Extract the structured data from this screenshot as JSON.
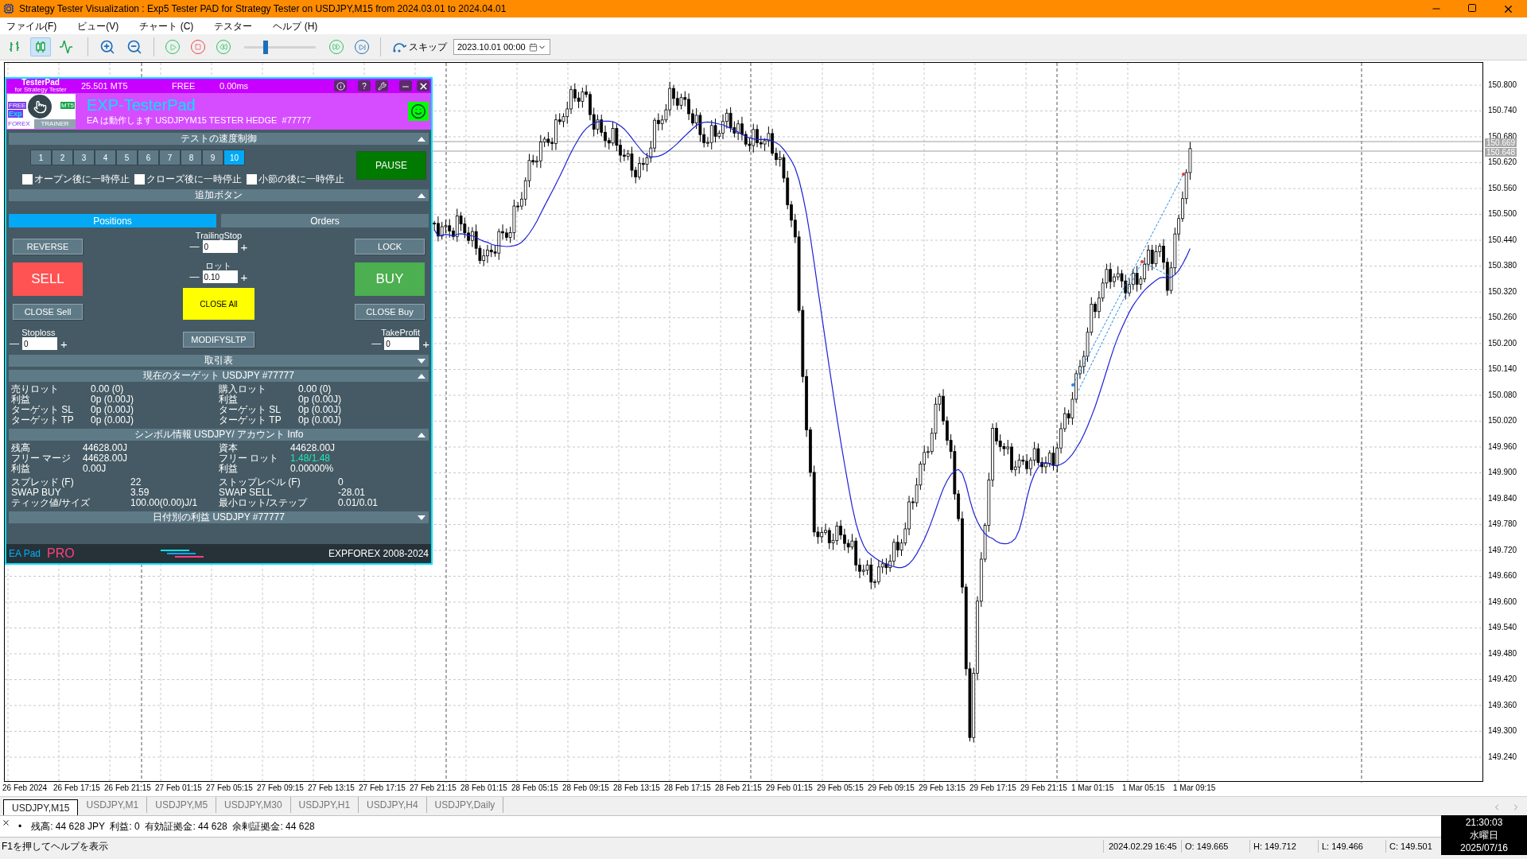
{
  "window": {
    "title": "Strategy Tester Visualization : Exp5 Tester PAD for Strategy Tester on USDJPY,M15 from 2024.03.01 to 2024.04.01"
  },
  "menu": [
    "ファイル(F)",
    "ビュー(V)",
    "チャート (C)",
    "テスター",
    "ヘルプ (H)"
  ],
  "toolbar": {
    "chart_modes": [
      {
        "kind": "bars",
        "selected": false
      },
      {
        "kind": "candles",
        "selected": true
      },
      {
        "kind": "line",
        "selected": false
      }
    ],
    "speed": {
      "level": 0.3
    },
    "skip": "スキップ",
    "date": "2023.10.01 00:00"
  },
  "pad": {
    "brand": "TesterPad",
    "brand_sub": "for Strategy Tester",
    "version": "25.501 MT5",
    "license": "FREE",
    "latency": "0.00ms",
    "help": "?",
    "logo": {
      "free": "FREE",
      "mt5": "MT5",
      "exp": "Exp",
      "forex": "FOREX",
      "trainer": "TRAINER"
    },
    "title": "EXP-TesterPad",
    "status": "EA は動作します USDJPYM15 TESTER HEDGE  #77777",
    "speed_section": {
      "title": "テストの速度制御",
      "expanded": true
    },
    "speeds": [
      {
        "label": "1",
        "selected": false
      },
      {
        "label": "2",
        "selected": false
      },
      {
        "label": "3",
        "selected": false
      },
      {
        "label": "4",
        "selected": false
      },
      {
        "label": "5",
        "selected": false
      },
      {
        "label": "6",
        "selected": false
      },
      {
        "label": "7",
        "selected": false
      },
      {
        "label": "8",
        "selected": false
      },
      {
        "label": "9",
        "selected": false
      },
      {
        "label": "10",
        "selected": true
      }
    ],
    "pause": "PAUSE",
    "pause_options": [
      {
        "label": "オープン後に一時停止",
        "checked": false
      },
      {
        "label": "クローズ後に一時停止",
        "checked": false
      },
      {
        "label": "小節の後に一時停止",
        "checked": false
      }
    ],
    "extra_section": {
      "title": "追加ボタン",
      "expanded": true
    },
    "tabs": [
      {
        "label": "Positions",
        "selected": true
      },
      {
        "label": "Orders",
        "selected": false
      }
    ],
    "reverse": "REVERSE",
    "lock": "LOCK",
    "sell": "SELL",
    "buy": "BUY",
    "close_sell": "CLOSE Sell",
    "close_all": "CLOSE All",
    "close_buy": "CLOSE Buy",
    "modify": "MODIFYSLTP",
    "trailing": {
      "label": "TrailingStop",
      "value": "0"
    },
    "lot": {
      "label": "ロット",
      "value": "0.10"
    },
    "stoploss": {
      "label": "Stoploss",
      "value": "0"
    },
    "takeprofit": {
      "label": "TakeProfit",
      "value": "0"
    },
    "minus": "—",
    "plus": "+",
    "trade_section": {
      "title": "取引表",
      "expanded": false
    },
    "target_section": {
      "title": "現在のターゲット USDJPY #77777",
      "expanded": true
    },
    "target": {
      "left": [
        {
          "label": "売りロット",
          "value": "0.00 (0)"
        },
        {
          "label": "利益",
          "value": "0p (0.00J)"
        },
        {
          "label": "ターゲット SL",
          "value": "0p (0.00J)"
        },
        {
          "label": "ターゲット TP",
          "value": "0p (0.00J)"
        }
      ],
      "right": [
        {
          "label": "購入ロット",
          "value": "0.00 (0)"
        },
        {
          "label": "利益",
          "value": "0p (0.00J)"
        },
        {
          "label": "ターゲット SL",
          "value": "0p (0.00J)"
        },
        {
          "label": "ターゲット TP",
          "value": "0p (0.00J)"
        }
      ]
    },
    "symbol_section": {
      "title": "シンボル情報 USDJPY/ アカウント Info",
      "expanded": true
    },
    "account": {
      "left": [
        {
          "label": "残高",
          "value": "44628.00J",
          "highlighted": false
        },
        {
          "label": "フリー マージ",
          "value": "44628.00J",
          "highlighted": false
        },
        {
          "label": "利益",
          "value": "0.00J",
          "highlighted": false
        }
      ],
      "right": [
        {
          "label": "資本",
          "value": "44628.00J",
          "highlighted": false
        },
        {
          "label": "フリー ロット",
          "value": "1.48/1.48",
          "highlighted": true
        },
        {
          "label": "利益",
          "value": "0.00000%",
          "highlighted": false
        }
      ]
    },
    "symbol": {
      "left": [
        {
          "label": "スプレッド (F)",
          "value": "22"
        },
        {
          "label": "SWAP BUY",
          "value": "3.59"
        },
        {
          "label": "ティック値/サイズ",
          "value": "100.00(0.00)J/1"
        }
      ],
      "right": [
        {
          "label": "ストップレベル (F)",
          "value": "0"
        },
        {
          "label": "SWAP SELL",
          "value": "-28.01"
        },
        {
          "label": "最小ロット/ステップ",
          "value": "0.01/0.01"
        }
      ]
    },
    "daily_section": {
      "title": "日付別の利益 USDJPY #77777",
      "expanded": false
    },
    "footer": {
      "ea": "EA Pad",
      "pro": "PRO",
      "copyright": "EXPFOREX 2008-2024"
    }
  },
  "price_axis": [
    "150.800",
    "150.740",
    "150.680",
    "150.620",
    "150.560",
    "150.500",
    "150.440",
    "150.380",
    "150.320",
    "150.260",
    "150.200",
    "150.140",
    "150.080",
    "150.020",
    "149.960",
    "149.900",
    "149.840",
    "149.780",
    "149.720",
    "149.660",
    "149.600",
    "149.540",
    "149.480",
    "149.420",
    "149.360",
    "149.300",
    "149.240"
  ],
  "price_tags": [
    "150.669",
    "150.648"
  ],
  "time_axis": [
    "26 Feb 2024",
    "26 Feb 17:15",
    "26 Feb 21:15",
    "27 Feb 01:15",
    "27 Feb 05:15",
    "27 Feb 09:15",
    "27 Feb 13:15",
    "27 Feb 17:15",
    "27 Feb 21:15",
    "28 Feb 01:15",
    "28 Feb 05:15",
    "28 Feb 09:15",
    "28 Feb 13:15",
    "28 Feb 17:15",
    "28 Feb 21:15",
    "29 Feb 01:15",
    "29 Feb 05:15",
    "29 Feb 09:15",
    "29 Feb 13:15",
    "29 Feb 17:15",
    "29 Feb 21:15",
    "1 Mar 01:15",
    "1 Mar 05:15",
    "1 Mar 09:15"
  ],
  "chart_tabs": [
    {
      "label": "USDJPY,M15",
      "selected": true
    },
    {
      "label": "USDJPY,M1",
      "selected": false
    },
    {
      "label": "USDJPY,M5",
      "selected": false
    },
    {
      "label": "USDJPY,M30",
      "selected": false
    },
    {
      "label": "USDJPY,H1",
      "selected": false
    },
    {
      "label": "USDJPY,H4",
      "selected": false
    },
    {
      "label": "USDJPY,Daily",
      "selected": false
    }
  ],
  "journal": {
    "bullet": "•",
    "message": "残高: 44 628 JPY  利益: 0  有効証拠金: 44 628  余剰証拠金: 44 628"
  },
  "status_bar": {
    "help": "F1を押してヘルプを表示",
    "time": "2024.02.29 16:45",
    "open": "O: 149.665",
    "high": "H: 149.712",
    "low": "L: 149.466",
    "close": "C: 149.501"
  },
  "clock": {
    "time": "21:30:03",
    "weekday": "水曜日",
    "date": "2025/07/16"
  }
}
